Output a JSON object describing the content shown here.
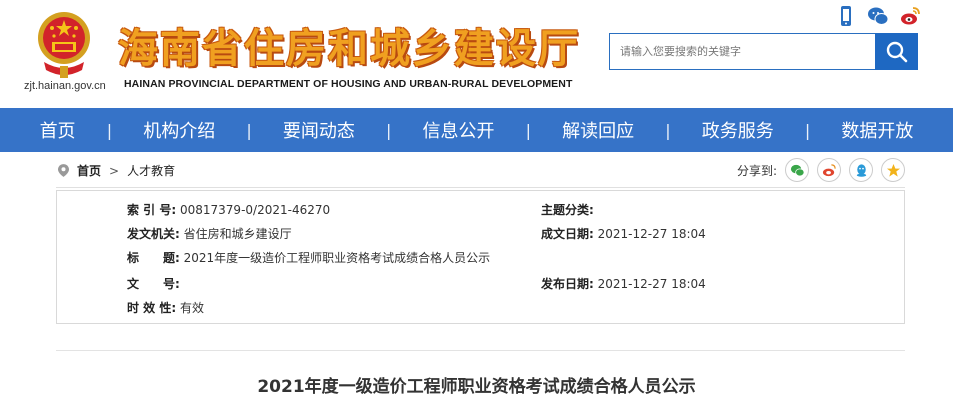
{
  "header": {
    "title": "海南省住房和城乡建设厅",
    "subtitle": "HAINAN PROVINCIAL DEPARTMENT OF HOUSING AND URBAN-RURAL DEVELOPMENT",
    "domain": "zjt.hainan.gov.cn",
    "social_icons": [
      "mobile-icon",
      "wechat-icon",
      "weibo-icon"
    ]
  },
  "search": {
    "placeholder": "请输入您要搜索的关键字",
    "icon": "search-icon"
  },
  "nav": {
    "items": [
      "首页",
      "机构介绍",
      "要闻动态",
      "信息公开",
      "解读回应",
      "政务服务",
      "数据开放"
    ]
  },
  "breadcrumb": {
    "home": "首页",
    "current": "人才教育"
  },
  "share": {
    "label": "分享到:",
    "icons": [
      "wechat-icon",
      "weibo-icon",
      "qq-icon",
      "qzone-icon"
    ]
  },
  "meta": {
    "index_label": "索 引 号:",
    "index_value": "00817379-0/2021-46270",
    "topic_label": "主题分类:",
    "topic_value": "",
    "org_label": "发文机关:",
    "org_value": "省住房和城乡建设厅",
    "created_label": "成文日期:",
    "created_value": "2021-12-27 18:04",
    "title_label": "标　　题:",
    "title_value": "2021年度一级造价工程师职业资格考试成绩合格人员公示",
    "docno_label": "文　　号:",
    "docno_value": "",
    "published_label": "发布日期:",
    "published_value": "2021-12-27 18:04",
    "validity_label": "时 效 性:",
    "validity_value": "有效"
  },
  "article": {
    "title": "2021年度一级造价工程师职业资格考试成绩合格人员公示"
  },
  "colors": {
    "nav_bg": "#3673c8",
    "title_orange": "#f0a020",
    "search_btn": "#1e68c2"
  }
}
